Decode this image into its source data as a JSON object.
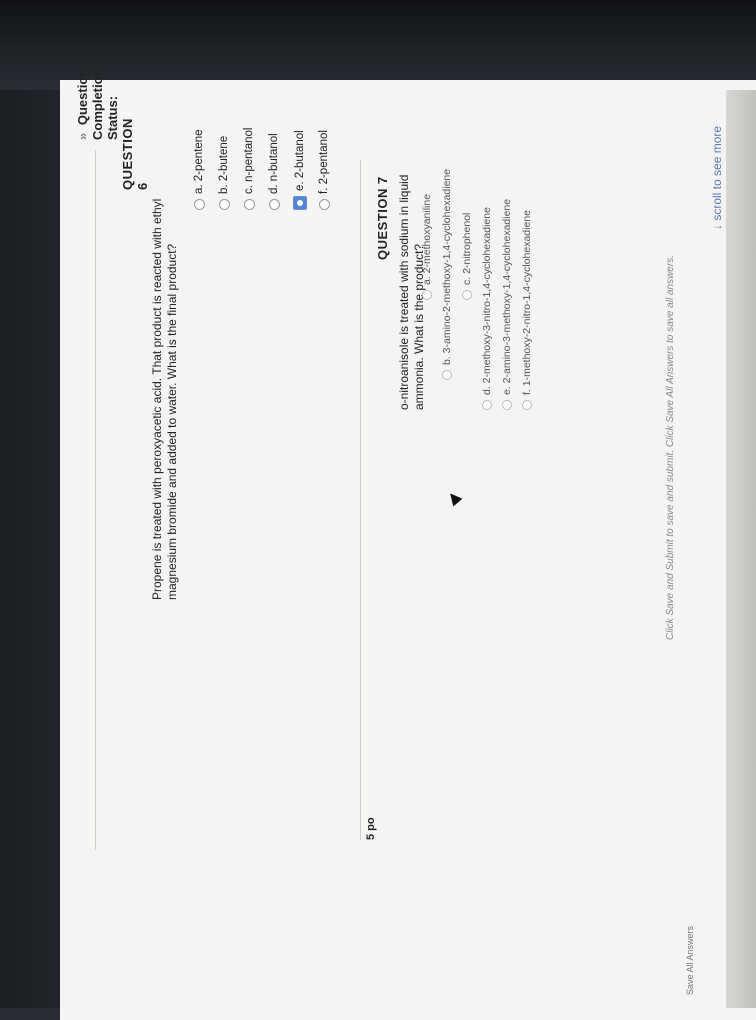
{
  "status": {
    "chevron": "»",
    "title": "Question Completion Status:"
  },
  "question6": {
    "title": "QUESTION 6",
    "text_line1": "Propene is treated with peroxyacetic acid. That product is reacted with ethyl magnesium bromide and added to water. What is the",
    "text_line2": "final product?",
    "options": [
      {
        "label": "a. 2-pentene",
        "selected": false
      },
      {
        "label": "b. 2-butene",
        "selected": false
      },
      {
        "label": "c. n-pentanol",
        "selected": false
      },
      {
        "label": "d. n-butanol",
        "selected": false
      },
      {
        "label": "e. 2-butanol",
        "selected": true
      },
      {
        "label": "f. 2-pentanol",
        "selected": false
      }
    ]
  },
  "question7": {
    "title": "QUESTION 7",
    "points": "5 po",
    "text": "o-nitroanisole is treated with sodium in liquid ammonia. What is the product?",
    "options": [
      {
        "label": "a. 2-methoxyaniline"
      },
      {
        "label": "b. 3-amino-2-methoxy-1,4-cyclohexadiene"
      },
      {
        "label": "c. 2-nitrophenol"
      },
      {
        "label": "d. 2-methoxy-3-nitro-1,4-cyclohexadiene"
      },
      {
        "label": "e. 2-amino-3-methoxy-1,4-cyclohexadiene"
      },
      {
        "label": "f. 1-methoxy-2-nitro-1,4-cyclohexadiene"
      }
    ]
  },
  "footer": {
    "note": "Click Save and Submit to save and submit. Click Save All Answers to save all answers.",
    "scroll_more": "scroll to see more",
    "save_all": "Save All Answers"
  }
}
